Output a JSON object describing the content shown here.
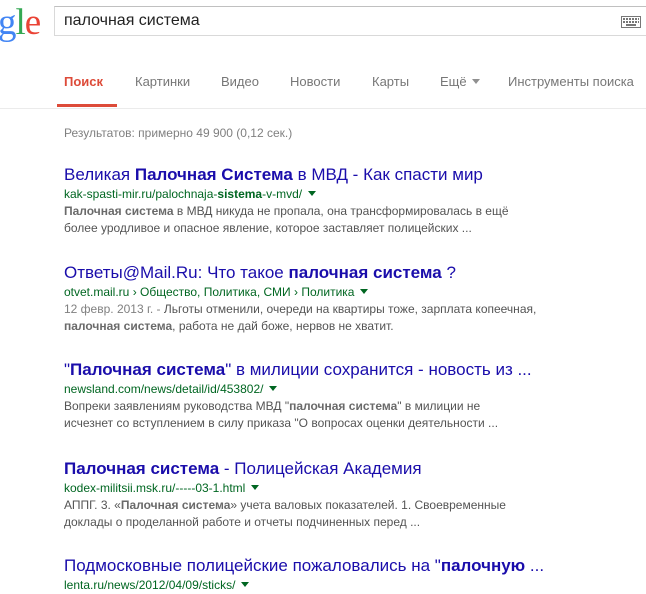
{
  "logo": {
    "visible_letters": "gle"
  },
  "search": {
    "query": "палочная система"
  },
  "nav": {
    "tabs": [
      {
        "label": "Поиск",
        "active": true
      },
      {
        "label": "Картинки"
      },
      {
        "label": "Видео"
      },
      {
        "label": "Новости"
      },
      {
        "label": "Карты"
      },
      {
        "label": "Ещё"
      },
      {
        "label": "Инструменты поиска"
      }
    ]
  },
  "stats": "Результатов: примерно 49 900 (0,12 сек.)",
  "results": [
    {
      "title": [
        {
          "text": "Великая "
        },
        {
          "text": "Палочная Система",
          "bold": true
        },
        {
          "text": " в МВД - Как спасти мир"
        }
      ],
      "url": [
        {
          "text": "kak-spasti-mir.ru/palochnaja-"
        },
        {
          "text": "sistema",
          "bold": true
        },
        {
          "text": "-v-mvd/"
        }
      ],
      "snippet": [
        [
          {
            "text": "Палочная система",
            "bold": true
          },
          {
            "text": " в МВД никуда не пропала, она трансформировалась в ещё"
          }
        ],
        [
          {
            "text": "более уродливое и опасное явление, которое заставляет полицейских ..."
          }
        ]
      ]
    },
    {
      "title": [
        {
          "text": "Ответы@Mail.Ru: Что такое "
        },
        {
          "text": "палочная система",
          "bold": true
        },
        {
          "text": " ?"
        }
      ],
      "url": [
        {
          "text": "otvet.mail.ru › Общество, Политика, СМИ › Политика"
        }
      ],
      "snippet": [
        [
          {
            "text": "12 февр. 2013 г. - ",
            "date": true
          },
          {
            "text": "Льготы отменили, очереди на квартиры тоже, зарплата копеечная,"
          }
        ],
        [
          {
            "text": "палочная система",
            "bold": true
          },
          {
            "text": ", работа не дай боже, нервов не хватит."
          }
        ]
      ]
    },
    {
      "title": [
        {
          "text": "\""
        },
        {
          "text": "Палочная система",
          "bold": true
        },
        {
          "text": "\" в милиции сохранится - новость из ..."
        }
      ],
      "url": [
        {
          "text": "newsland.com/news/detail/id/453802/"
        }
      ],
      "snippet": [
        [
          {
            "text": "Вопреки заявлениям руководства МВД \""
          },
          {
            "text": "палочная система",
            "bold": true
          },
          {
            "text": "\" в милиции не"
          }
        ],
        [
          {
            "text": "исчезнет со вступлением в силу приказа \"О вопросах оценки деятельности ..."
          }
        ]
      ]
    },
    {
      "title": [
        {
          "text": "Палочная система",
          "bold": true
        },
        {
          "text": " - Полицейская Академия"
        }
      ],
      "url": [
        {
          "text": "kodex-militsii.msk.ru/-----03-1.html"
        }
      ],
      "snippet": [
        [
          {
            "text": "АППГ. 3. «"
          },
          {
            "text": "Палочная система",
            "bold": true
          },
          {
            "text": "» учета валовых показателей. 1. Своевременные"
          }
        ],
        [
          {
            "text": "доклады о проделанной работе и отчеты подчиненных перед ..."
          }
        ]
      ]
    },
    {
      "title": [
        {
          "text": "Подмосковные полицейские пожаловались на \""
        },
        {
          "text": "палочную",
          "bold": true
        },
        {
          "text": " ..."
        }
      ],
      "url": [
        {
          "text": "lenta.ru/news/2012/04/09/sticks/"
        }
      ],
      "snippet": []
    }
  ],
  "colors": {
    "link": "#1a0dab",
    "url": "#006621",
    "snippet": "#545454",
    "active_tab": "#dd4b39",
    "tab": "#777777"
  },
  "icons": [
    "keyboard-icon",
    "dropdown-arrow-icon",
    "caret-down-icon"
  ]
}
